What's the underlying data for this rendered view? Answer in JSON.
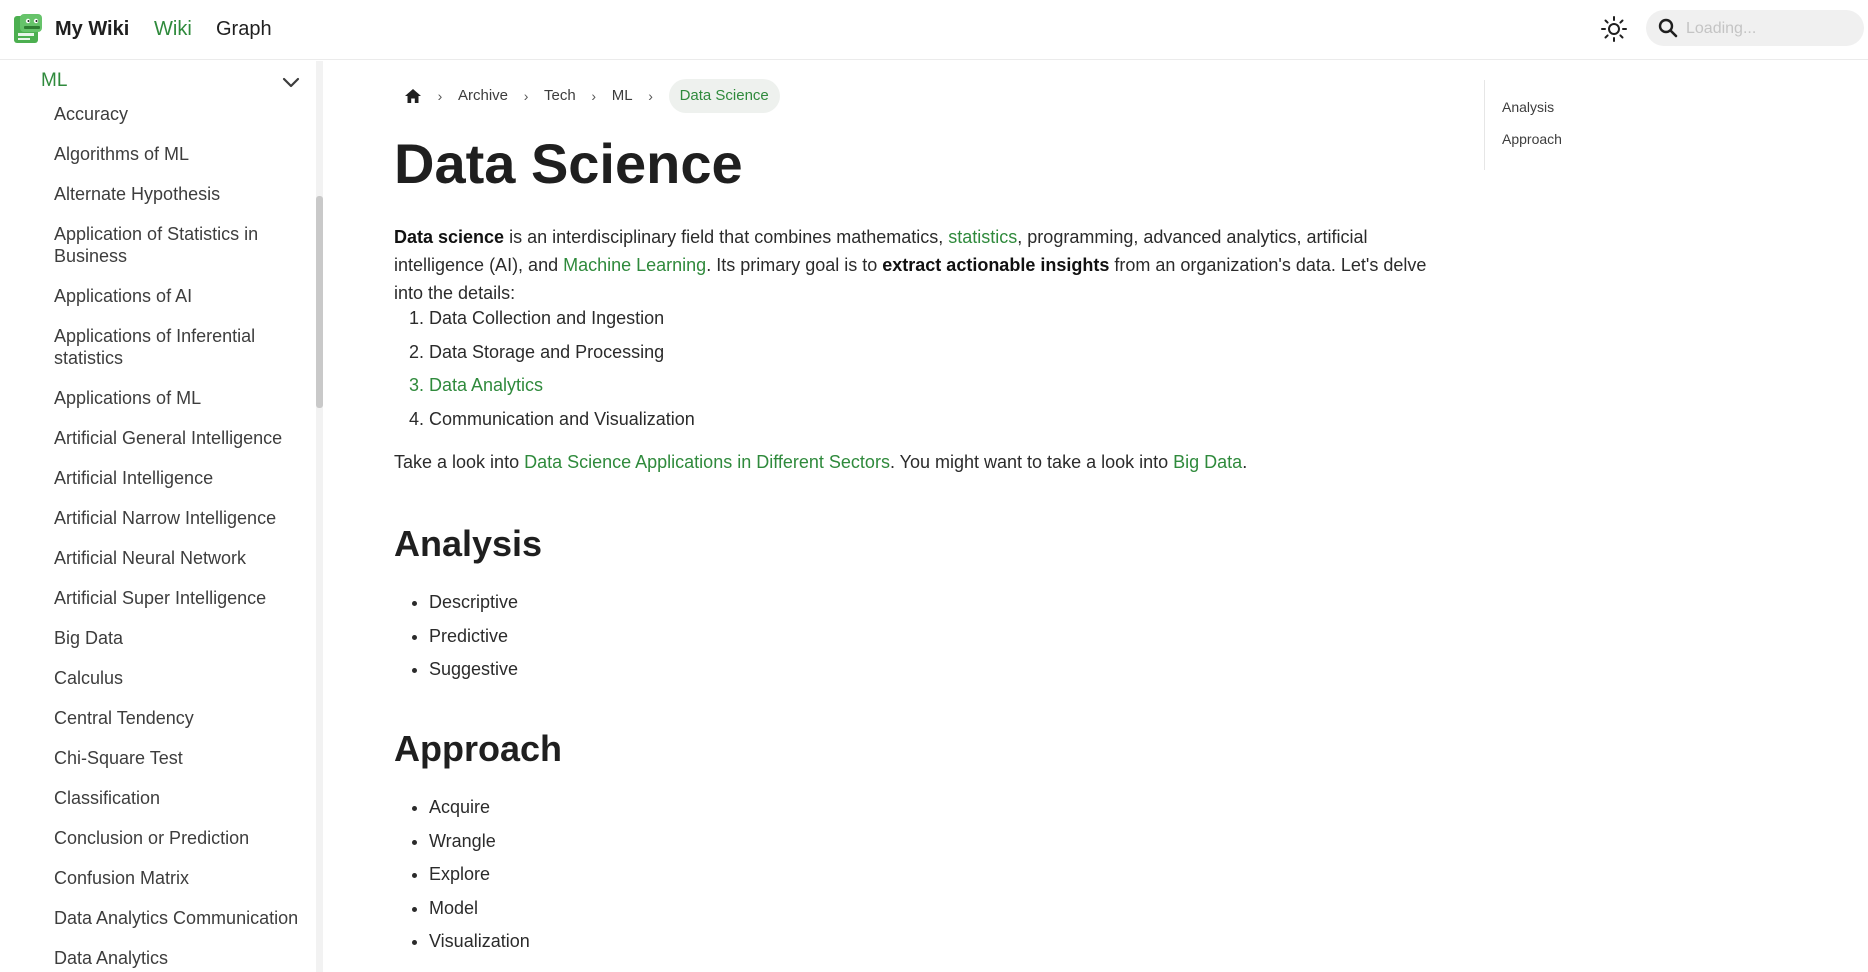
{
  "header": {
    "site_title": "My Wiki",
    "nav": [
      {
        "label": "Wiki",
        "active": true
      },
      {
        "label": "Graph",
        "active": false
      }
    ],
    "theme_icon": "sun-icon",
    "search": {
      "placeholder": "Loading...",
      "icon": "search-icon"
    }
  },
  "sidebar": {
    "section": "ML",
    "items": [
      "Accuracy",
      "Algorithms of ML",
      "Alternate Hypothesis",
      "Application of Statistics in Business",
      "Applications of AI",
      "Applications of Inferential statistics",
      "Applications of ML",
      "Artificial General Intelligence",
      "Artificial Intelligence",
      "Artificial Narrow Intelligence",
      "Artificial Neural Network",
      "Artificial Super Intelligence",
      "Big Data",
      "Calculus",
      "Central Tendency",
      "Chi-Square Test",
      "Classification",
      "Conclusion or Prediction",
      "Confusion Matrix",
      "Data Analytics Communication",
      "Data Analytics"
    ]
  },
  "breadcrumb": {
    "home_icon": "home-icon",
    "items": [
      "Archive",
      "Tech",
      "ML"
    ],
    "current": "Data Science",
    "separator": "›"
  },
  "article": {
    "title": "Data Science",
    "intro": {
      "b1": "Data science",
      "t1": " is an interdisciplinary field that combines mathematics, ",
      "l1": "statistics",
      "t2": ", programming, advanced analytics, artificial intelligence (AI), and ",
      "l2": "Machine Learning",
      "t3": ". Its primary goal is to ",
      "b2": "extract actionable insights",
      "t4": " from an organization's data. Let's delve into the details:"
    },
    "steps": [
      {
        "text": "Data Collection and Ingestion",
        "link": false
      },
      {
        "text": "Data Storage and Processing",
        "link": false
      },
      {
        "text": "Data Analytics",
        "link": true
      },
      {
        "text": "Communication and Visualization",
        "link": false
      }
    ],
    "followup": {
      "t1": "Take a look into ",
      "l1": "Data Science Applications in Different Sectors",
      "t2": ". You might want to take a look into ",
      "l2": "Big Data",
      "t3": "."
    },
    "analysis": {
      "heading": "Analysis",
      "items": [
        "Descriptive",
        "Predictive",
        "Suggestive"
      ]
    },
    "approach": {
      "heading": "Approach",
      "items": [
        "Acquire",
        "Wrangle",
        "Explore",
        "Model",
        "Visualization"
      ]
    }
  },
  "toc": {
    "items": [
      "Analysis",
      "Approach"
    ]
  },
  "colors": {
    "accent": "#2f8a3c",
    "text": "#1f1f1f",
    "breadcrumb_current_bg": "#eef1ee"
  }
}
